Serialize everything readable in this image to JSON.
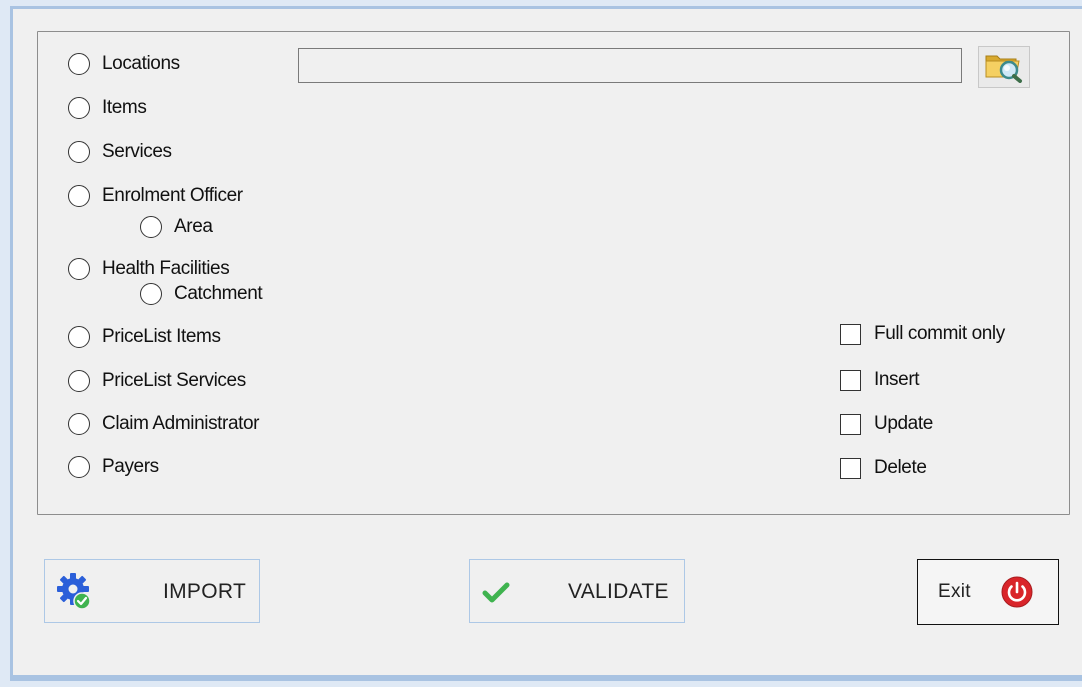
{
  "radios": [
    {
      "name": "radio-locations",
      "label": "Locations"
    },
    {
      "name": "radio-items",
      "label": "Items"
    },
    {
      "name": "radio-services",
      "label": "Services"
    },
    {
      "name": "radio-enrolment-officer",
      "label": "Enrolment Officer"
    },
    {
      "name": "radio-area",
      "label": "Area"
    },
    {
      "name": "radio-health-facilities",
      "label": "Health Facilities"
    },
    {
      "name": "radio-catchment",
      "label": "Catchment"
    },
    {
      "name": "radio-pricelist-items",
      "label": "PriceList Items"
    },
    {
      "name": "radio-pricelist-services",
      "label": "PriceList Services"
    },
    {
      "name": "radio-claim-administrator",
      "label": "Claim Administrator"
    },
    {
      "name": "radio-payers",
      "label": "Payers"
    }
  ],
  "file_path": {
    "value": ""
  },
  "browse_icon": "folder-search-icon",
  "checkboxes": [
    {
      "name": "checkbox-full-commit-only",
      "label": "Full commit only",
      "checked": false
    },
    {
      "name": "checkbox-insert",
      "label": "Insert",
      "checked": false
    },
    {
      "name": "checkbox-update",
      "label": "Update",
      "checked": false
    },
    {
      "name": "checkbox-delete",
      "label": "Delete",
      "checked": false
    }
  ],
  "buttons": {
    "import": {
      "label": "IMPORT",
      "icon": "gear-check-icon"
    },
    "validate": {
      "label": "VALIDATE",
      "icon": "checkmark-icon"
    },
    "exit": {
      "label": "Exit",
      "icon": "power-icon"
    }
  },
  "colors": {
    "accent_border": "#adc8e6",
    "power_red": "#d9252a",
    "check_green": "#3fb34f",
    "gear_blue": "#2b5fd9"
  }
}
